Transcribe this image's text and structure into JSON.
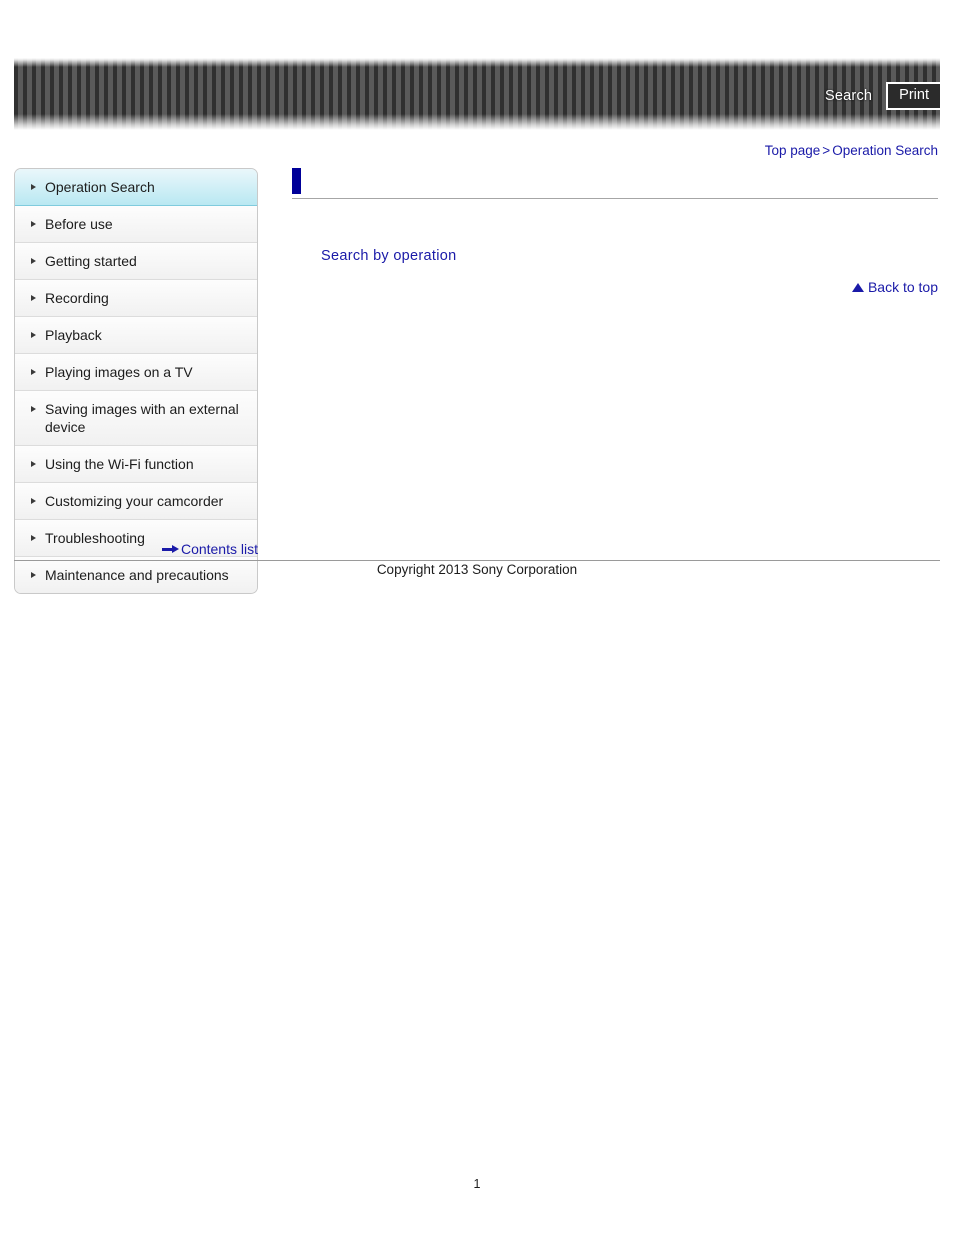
{
  "header": {
    "search_label": "Search",
    "print_label": "Print"
  },
  "breadcrumb": {
    "top_page": "Top page",
    "separator": ">",
    "current": "Operation Search"
  },
  "sidebar": {
    "items": [
      {
        "label": "Operation Search",
        "selected": true
      },
      {
        "label": "Before use",
        "selected": false
      },
      {
        "label": "Getting started",
        "selected": false
      },
      {
        "label": "Recording",
        "selected": false
      },
      {
        "label": "Playback",
        "selected": false
      },
      {
        "label": "Playing images on a TV",
        "selected": false
      },
      {
        "label": "Saving images with an external device",
        "selected": false
      },
      {
        "label": "Using the Wi-Fi function",
        "selected": false
      },
      {
        "label": "Customizing your camcorder",
        "selected": false
      },
      {
        "label": "Troubleshooting",
        "selected": false
      },
      {
        "label": "Maintenance and precautions",
        "selected": false
      }
    ],
    "contents_list_label": "Contents list"
  },
  "main": {
    "heading": "",
    "operation_link": "Search by operation",
    "back_to_top_label": "Back to top"
  },
  "footer": {
    "copyright": "Copyright 2013 Sony Corporation",
    "page_number": "1"
  },
  "colors": {
    "link": "#1a1aa8",
    "heading_marker": "#000099",
    "selected_nav": "#b9e8f2",
    "header_stripe_dark": "#303030",
    "header_stripe_light": "#5a5a5a"
  }
}
